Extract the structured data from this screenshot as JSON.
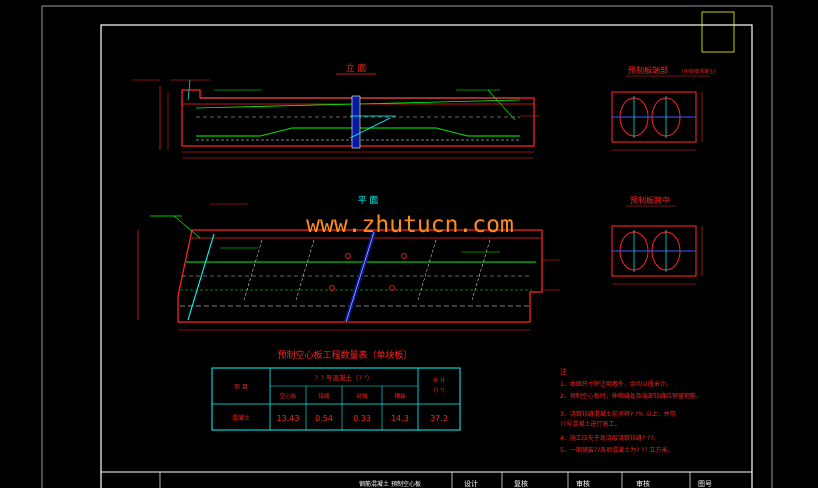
{
  "watermark": "www.zhutucn.com",
  "elevation": {
    "title": "立 面"
  },
  "plan": {
    "title": "平 面"
  },
  "end_section": {
    "title": "预制板端部",
    "note": "(中铰缝混凝土)"
  },
  "mid_section": {
    "title": "预制板跨中"
  },
  "table": {
    "title": "预制空心板工程数量表（单块板）",
    "header_item": "项 目",
    "header_concrete": "? ? 号混凝土（? ³）",
    "header_total": "合 计",
    "header_total_unit": "（? ³）",
    "sub_headers": [
      "空心板",
      "铰缝",
      "封端",
      "铺装"
    ],
    "row_label": "混凝土",
    "row_values": [
      "13.43",
      "0.54",
      "0.33",
      "14.3",
      "37.2"
    ]
  },
  "notes": {
    "heading": "注",
    "lines": [
      "1、本图尺寸除注明者外，余均以厘米计。",
      "2、预制空心板时，伸缩缝处及端部铰缝应预留钢筋，",
      "3、浇筑铰缝混凝土前须将? ?% 以上，并可",
      "   ??号混凝土进行施工。",
      "4、施工应先于现浇层浇筑铰缝? ??。",
      "5、一期铺装??各项混凝土为? ?? 立方米。"
    ]
  },
  "title_block": {
    "drawing": "钢筋混凝土 预制空心板",
    "design": "设计",
    "review": "复核",
    "check": "审核",
    "approve": "审核",
    "sheet": "图号"
  }
}
